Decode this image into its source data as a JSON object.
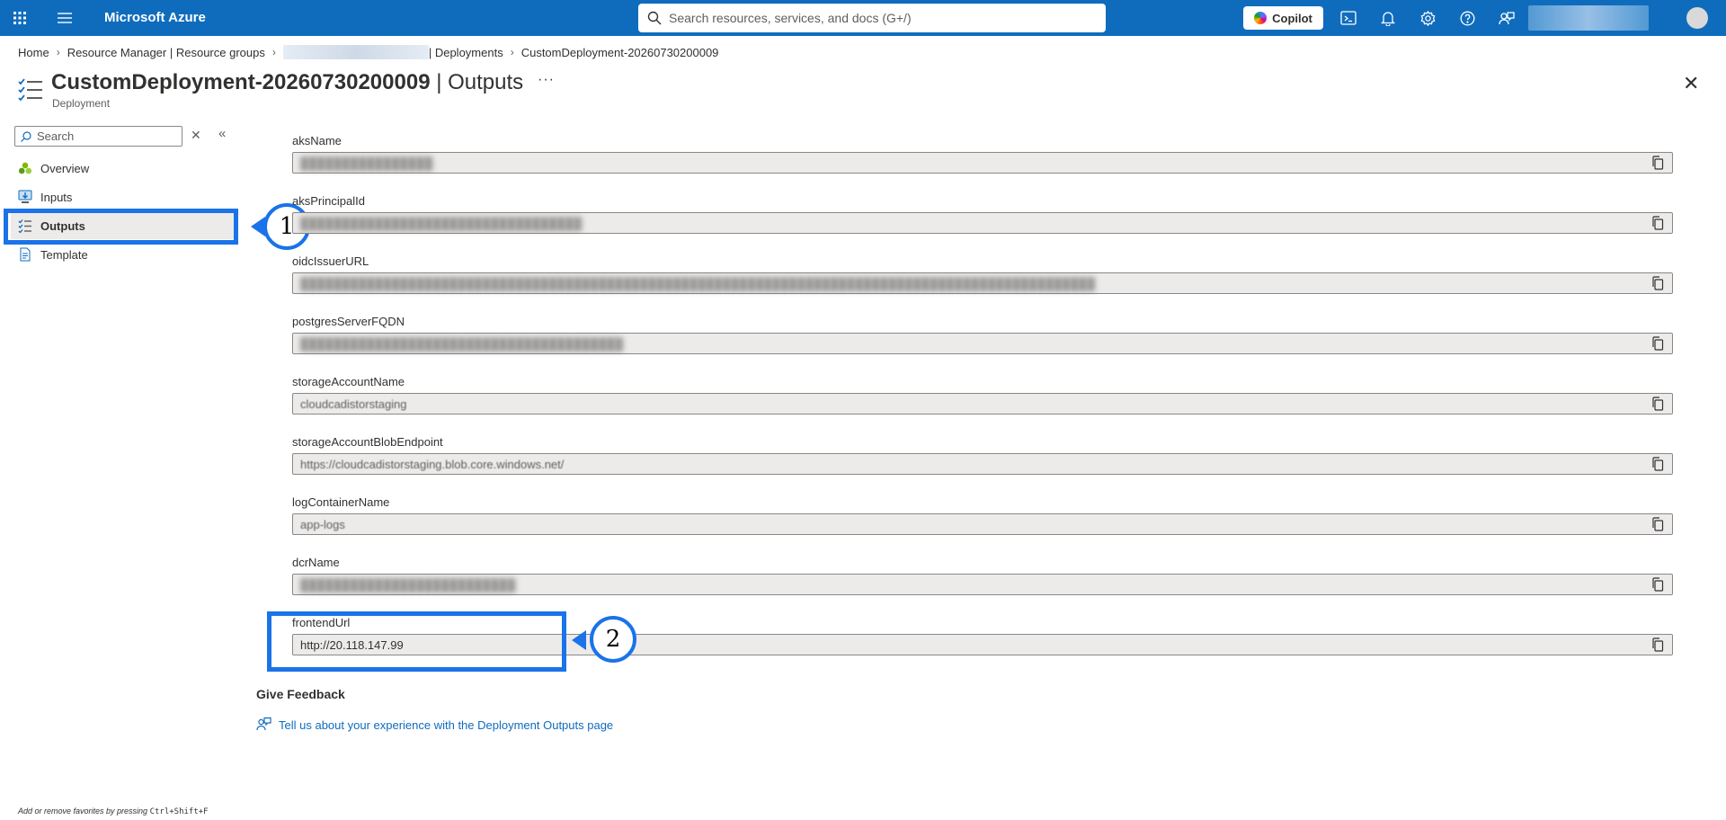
{
  "topbar": {
    "brand": "Microsoft Azure",
    "search_placeholder": "Search resources, services, and docs (G+/)",
    "copilot_label": "Copilot",
    "icons": [
      "waffle-icon",
      "hamburger-icon",
      "cloud-shell-icon",
      "bell-icon",
      "settings-icon",
      "help-icon",
      "feedback-icon"
    ]
  },
  "breadcrumb": {
    "items": [
      "Home",
      "Resource Manager | Resource groups",
      "| Deployments",
      "CustomDeployment-20260730200009"
    ]
  },
  "header": {
    "title_main": "CustomDeployment-20260730200009",
    "title_suffix": " | Outputs",
    "subtitle": "Deployment",
    "more": "···",
    "close": "✕"
  },
  "nav": {
    "search_placeholder": "Search",
    "items": [
      {
        "label": "Overview",
        "icon": "overview-icon"
      },
      {
        "label": "Inputs",
        "icon": "inputs-icon"
      },
      {
        "label": "Outputs",
        "icon": "outputs-icon",
        "active": true
      },
      {
        "label": "Template",
        "icon": "template-icon"
      }
    ]
  },
  "annotations": {
    "callout_1": "1",
    "callout_2": "2"
  },
  "outputs": [
    {
      "name": "aksName",
      "value": "████████████████",
      "redacted": true
    },
    {
      "name": "aksPrincipalId",
      "value": "██████████████████████████████████",
      "redacted": true
    },
    {
      "name": "oidcIssuerURL",
      "value": "████████████████████████████████████████████████████████████████████████████████████████████████",
      "redacted": true
    },
    {
      "name": "postgresServerFQDN",
      "value": "███████████████████████████████████████",
      "redacted": true
    },
    {
      "name": "storageAccountName",
      "value": "cloudcadistorstaging"
    },
    {
      "name": "storageAccountBlobEndpoint",
      "value": "https://cloudcadistorstaging.blob.core.windows.net/"
    },
    {
      "name": "logContainerName",
      "value": "app-logs"
    },
    {
      "name": "dcrName",
      "value": "██████████████████████████",
      "redacted": true
    },
    {
      "name": "frontendUrl",
      "value": "http://20.118.147.99"
    }
  ],
  "feedback": {
    "heading": "Give Feedback",
    "link": "Tell us about your experience with the Deployment Outputs page"
  },
  "status_bar": {
    "prefix": "Add or remove favorites by pressing ",
    "shortcut": "Ctrl+Shift+F"
  },
  "colors": {
    "topbar": "#0f6cbd",
    "highlight": "#1a73e8",
    "link": "#0f6cbd"
  }
}
